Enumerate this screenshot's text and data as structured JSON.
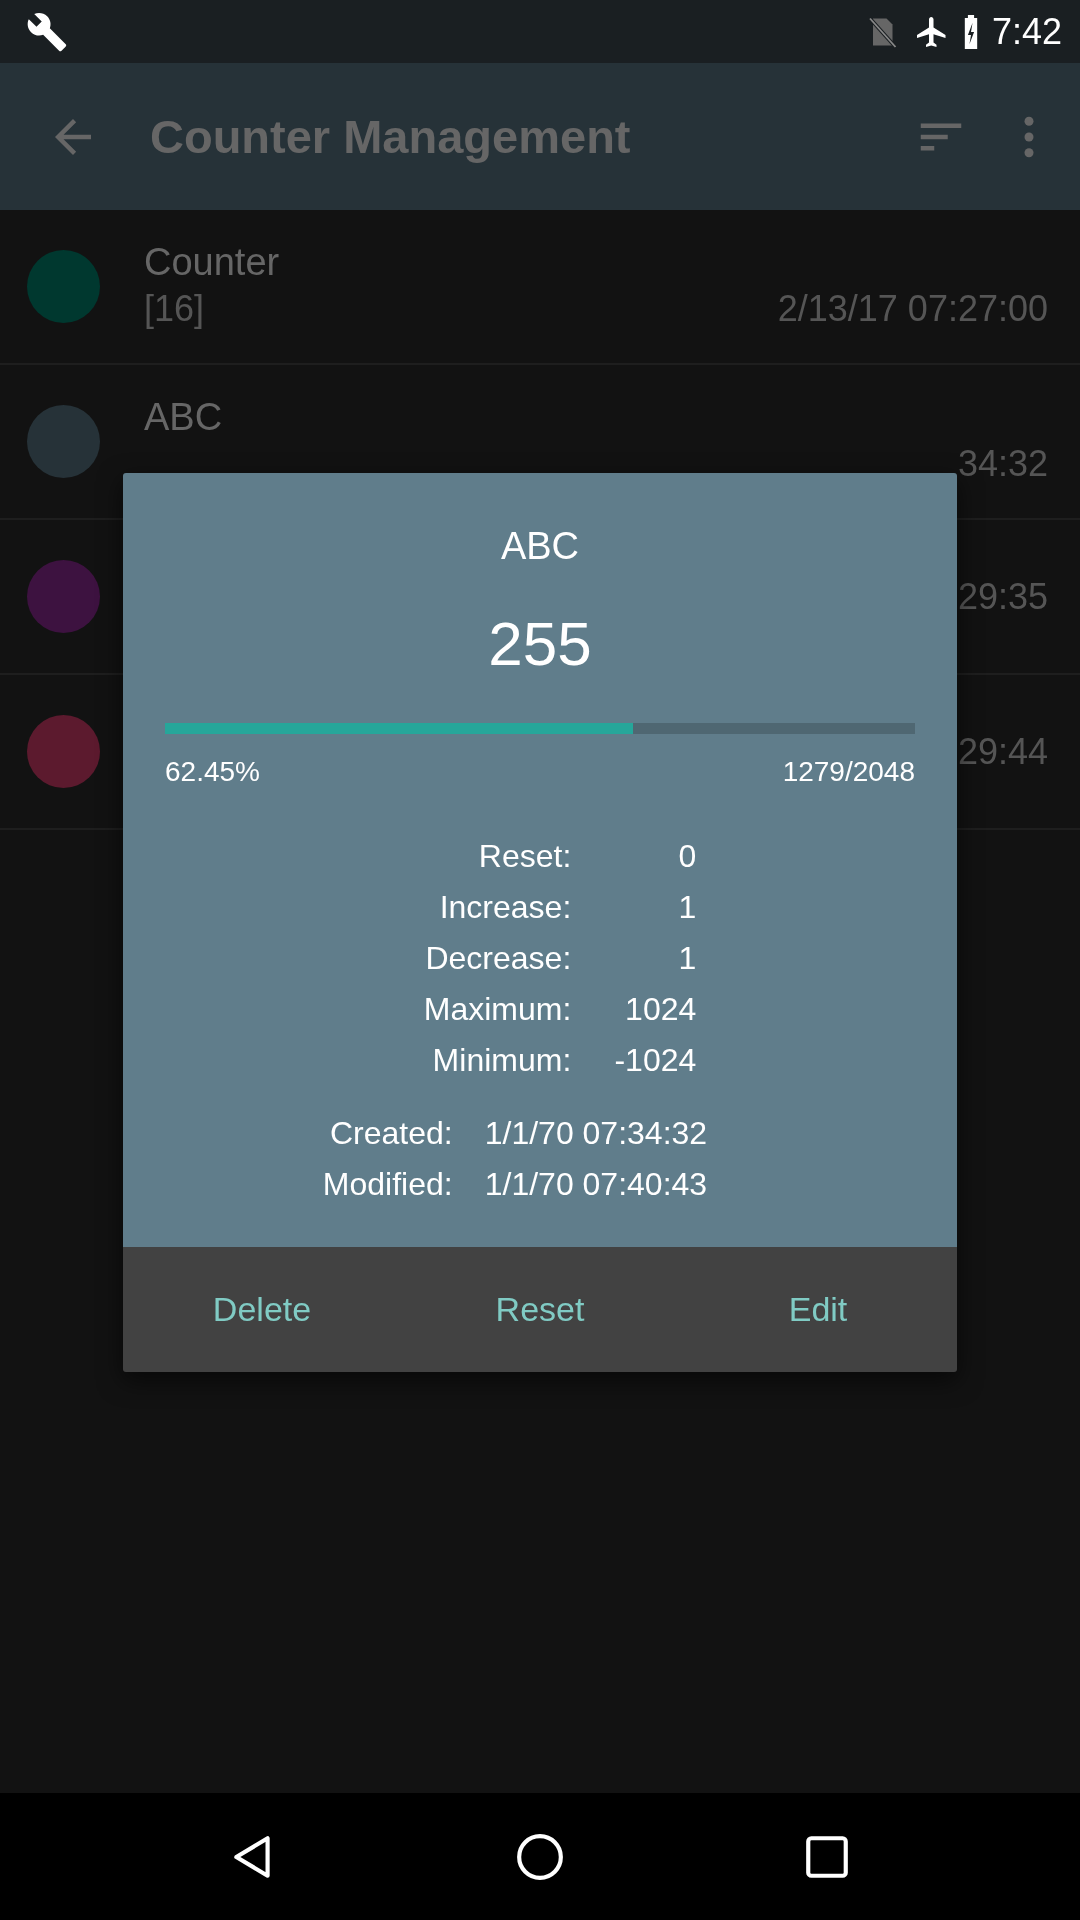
{
  "status_bar": {
    "time": "7:42"
  },
  "toolbar": {
    "title": "Counter Management"
  },
  "counters": [
    {
      "name": "Counter",
      "value": "[16]",
      "modified": "2/13/17 07:27:00",
      "color": "#00382f"
    },
    {
      "name": "ABC",
      "modified": "34:32",
      "color": "#263238"
    },
    {
      "modified": "29:35",
      "color": "#3d1240"
    },
    {
      "modified": "29:44",
      "color": "#5c1a2e"
    }
  ],
  "dialog": {
    "title": "ABC",
    "value": "255",
    "progress": {
      "level": 0.6245,
      "percent": "62.45%",
      "fraction": "1279/2048"
    },
    "stats": [
      {
        "label": "Reset:",
        "value": "0"
      },
      {
        "label": "Increase:",
        "value": "1"
      },
      {
        "label": "Decrease:",
        "value": "1"
      },
      {
        "label": "Maximum:",
        "value": "1024"
      },
      {
        "label": "Minimum:",
        "value": "-1024"
      }
    ],
    "dates": [
      {
        "label": "Created:",
        "value": "1/1/70 07:34:32"
      },
      {
        "label": "Modified:",
        "value": "1/1/70 07:40:43"
      }
    ],
    "buttons": [
      "Delete",
      "Reset",
      "Edit"
    ]
  }
}
